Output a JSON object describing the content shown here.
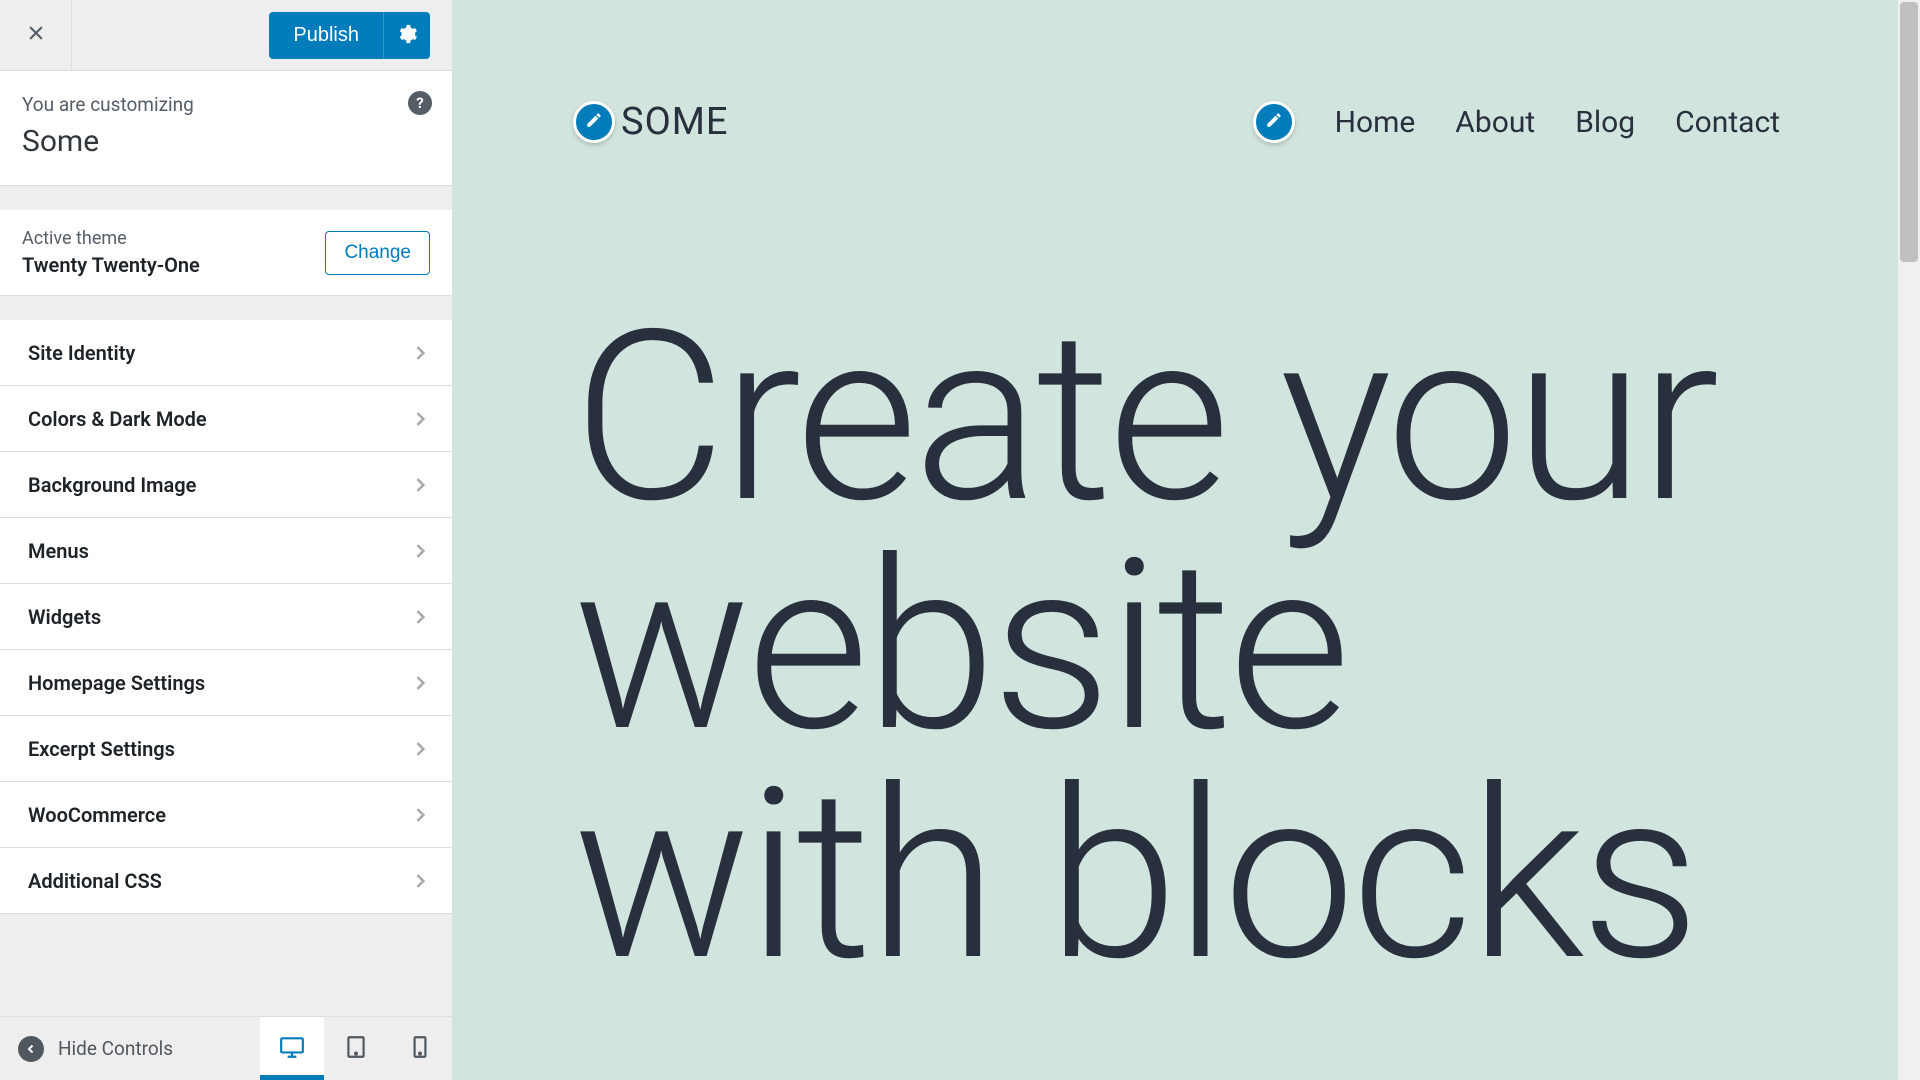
{
  "top": {
    "publish_label": "Publish"
  },
  "header": {
    "customizing_label": "You are customizing",
    "site_name": "Some",
    "help_symbol": "?"
  },
  "theme": {
    "active_label": "Active theme",
    "name": "Twenty Twenty-One",
    "change_label": "Change"
  },
  "panels": {
    "p0": "Site Identity",
    "p1": "Colors & Dark Mode",
    "p2": "Background Image",
    "p3": "Menus",
    "p4": "Widgets",
    "p5": "Homepage Settings",
    "p6": "Excerpt Settings",
    "p7": "WooCommerce",
    "p8": "Additional CSS"
  },
  "bottom": {
    "hide_label": "Hide Controls"
  },
  "preview": {
    "site_title": "SOME",
    "nav": {
      "n0": "Home",
      "n1": "About",
      "n2": "Blog",
      "n3": "Contact"
    },
    "hero": "Create your website with blocks"
  },
  "colors": {
    "accent": "#007cba",
    "preview_bg": "#d1e4dd",
    "preview_text": "#28303d"
  }
}
